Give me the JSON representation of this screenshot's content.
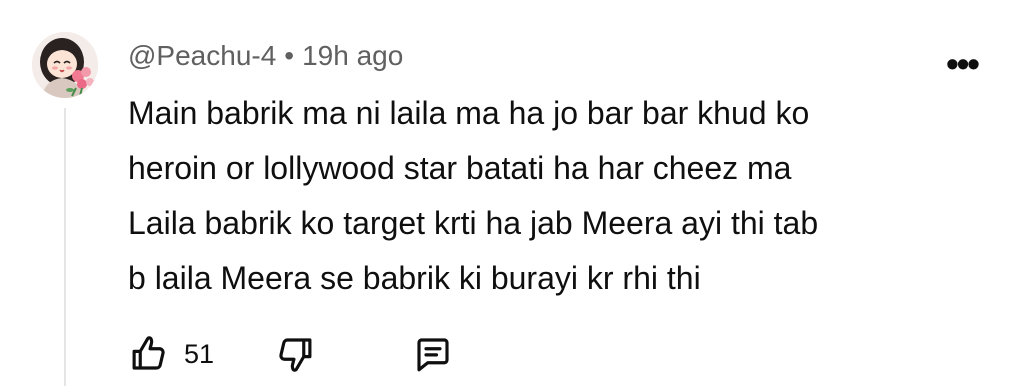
{
  "comment": {
    "author": "@Peachu-4",
    "separator": "•",
    "time": "19h ago",
    "text_lines": [
      "Main babrik ma ni laila ma ha jo bar bar khud ko",
      "heroin or lollywood star batati ha har cheez ma",
      "Laila babrik ko target krti ha jab Meera ayi thi tab",
      "b laila Meera se babrik ki burayi kr rhi thi"
    ],
    "like_count": "51",
    "menu_glyph": "•••"
  },
  "icons": {
    "avatar": "avatar-anime-girl-with-flowers",
    "like": "thumbs-up-icon",
    "dislike": "thumbs-down-icon",
    "reply": "comment-bubble-icon",
    "menu": "more-vertical-dots-icon"
  },
  "colors": {
    "text": "#0f0f0f",
    "meta": "#606060",
    "thread_line": "#e5e5e5"
  }
}
